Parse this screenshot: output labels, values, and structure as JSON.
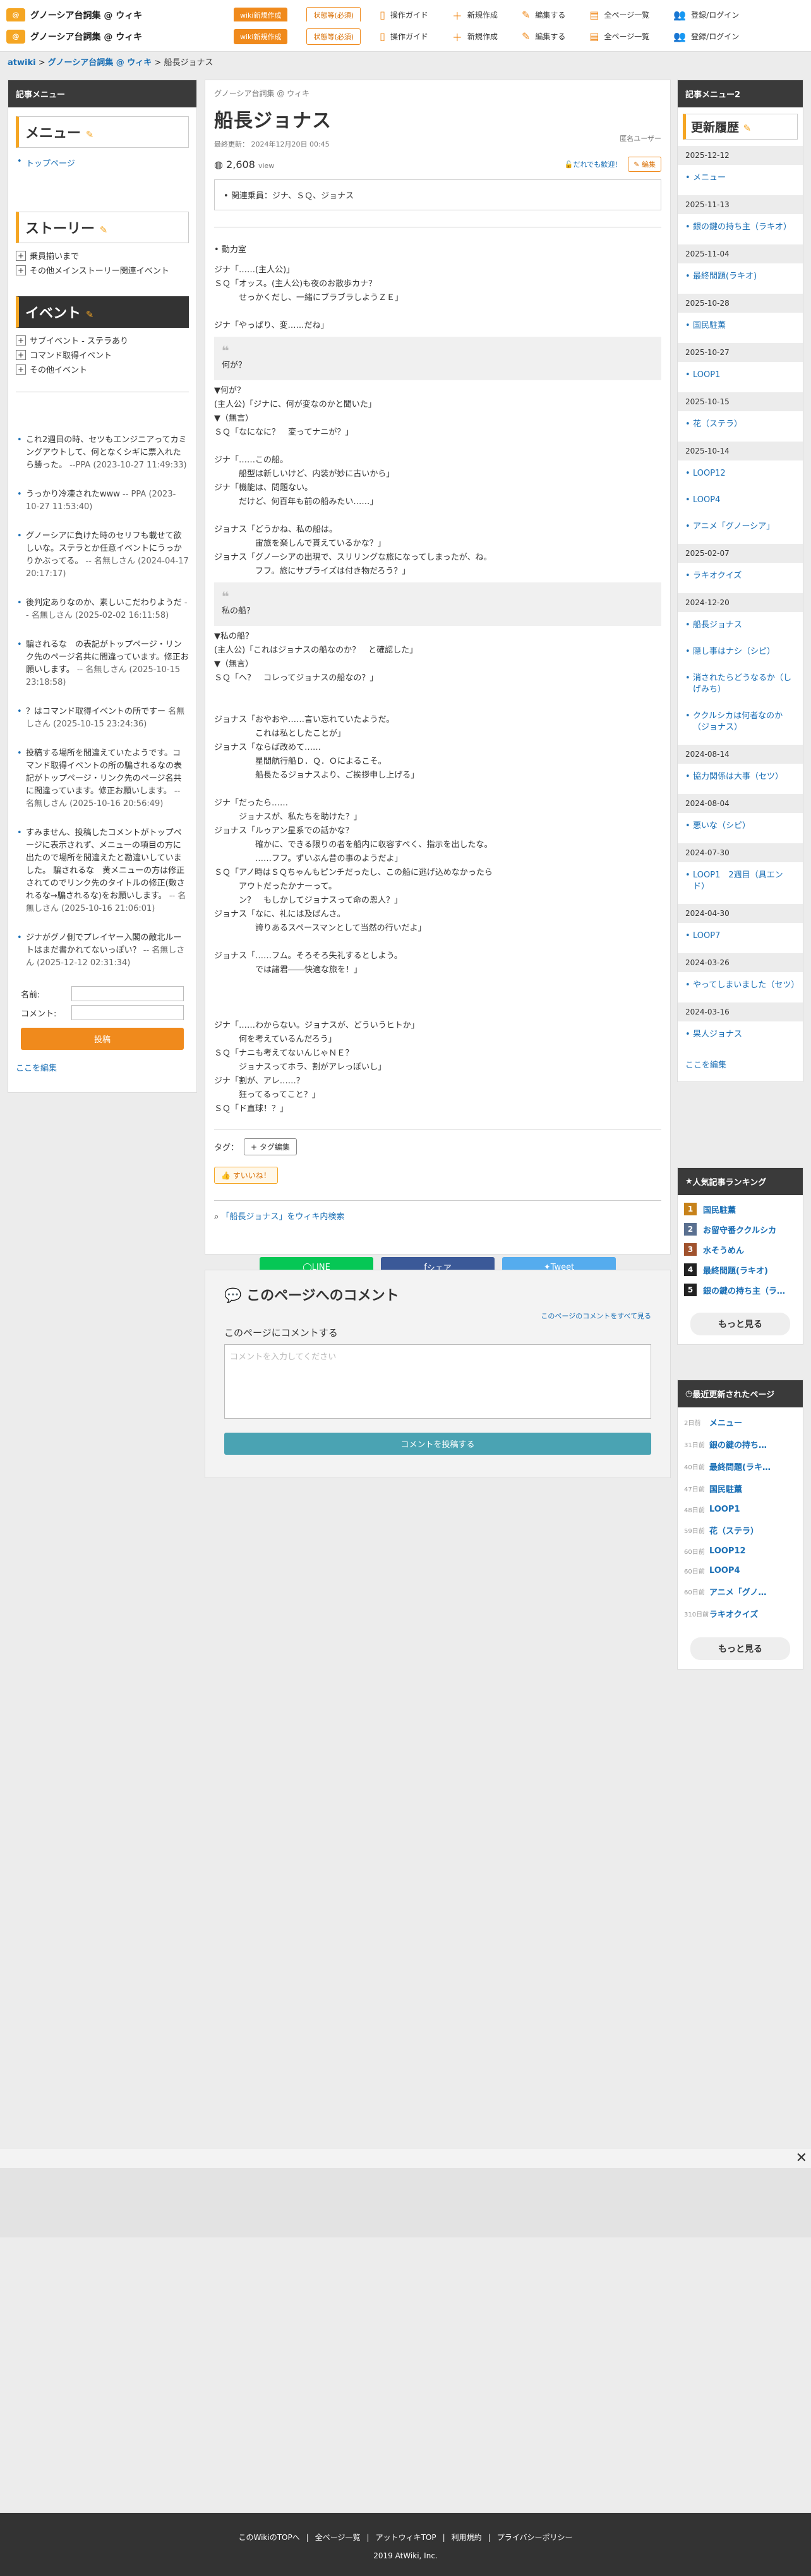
{
  "site": {
    "logo_mark": "@",
    "name": "グノーシア台詞集 @ ウィキ",
    "new_wiki_button": "wiki新規作成",
    "status_button": "状態等(必須)",
    "nav": [
      {
        "icon": "book-icon",
        "label": "操作ガイド"
      },
      {
        "icon": "plus-icon",
        "label": "新規作成"
      },
      {
        "icon": "pencil-icon",
        "label": "編集する"
      },
      {
        "icon": "list-icon",
        "label": "全ページ一覧"
      },
      {
        "icon": "users-icon",
        "label": "登録/ログイン"
      }
    ]
  },
  "breadcrumb": [
    "atwiki",
    "グノーシア台詞集 @ ウィキ",
    "船長ジョナス"
  ],
  "left_menu": {
    "header": "記事メニュー",
    "menu_title": "メニュー",
    "menu_items": [
      "トップページ"
    ],
    "story_title": "ストーリー",
    "story_items": [
      "乗員揃いまで",
      "その他メインストーリー関連イベント"
    ],
    "event_title": "イベント",
    "event_items": [
      "サブイベント - ステラあり",
      "コマンド取得イベント",
      "その他イベント"
    ],
    "comments": [
      {
        "text": "これ2週目の時、セツもエンジニアってカミングアウトして、何となくシギに票入れたら勝った。",
        "author": "--PPA (2023-10-27 11:49:33)"
      },
      {
        "text": "うっかり冷凍されたwww",
        "author": "-- PPA (2023-10-27 11:53:40)"
      },
      {
        "text": "グノーシアに負けた時のセリフも載せて欲しいな。ステラとか任意イベントにうっかりかぶってる。",
        "author": "-- 名無しさん (2024-04-17 20:17:17)"
      },
      {
        "text": "後判定ありなのか、素しいこだわりようだ",
        "author": "-- 名無しさん (2025-02-02 16:11:58)"
      },
      {
        "text": "騙されるな　の表記がトップページ・リンク先のページ名共に間違っています。修正お願いします。",
        "author": "-- 名無しさん (2025-10-15 23:18:58)"
      },
      {
        "text": "？はコマンド取得イベントの所ですー",
        "author": "名無しさん (2025-10-15 23:24:36)"
      },
      {
        "text": "投稿する場所を間違えていたようです。コマンド取得イベントの所の騙されるなの表記がトップページ・リンク先のページ名共に間違っています。修正お願いします。",
        "author": "-- 名無しさん (2025-10-16 20:56:49)"
      },
      {
        "text": "すみません、投稿したコメントがトップページに表示されず、メニューの項目の方に出たので場所を間違えたと勘違いしていました。 騙されるな　黄メニューの方は修正されてのでリンク先のタイトルの修正(敷されるな→騙されるな)をお願いします。",
        "author": "-- 名無しさん (2025-10-16 21:06:01)"
      },
      {
        "text": "ジナがグノ側でプレイヤー入閣の敵北ルートはまだ書かれてないっぽい？",
        "author": "-- 名無しさん (2025-12-12 02:31:34)"
      }
    ],
    "form": {
      "name_label": "名前:",
      "comment_label": "コメント:",
      "post": "投稿"
    },
    "edit_link": "ここを編集"
  },
  "main": {
    "site_label": "グノーシア台詞集 @ ウィキ",
    "title": "船長ジョナス",
    "updated": "最終更新： 2024年12月20日 00:45",
    "author": "匿名ユーザー",
    "views": "2,608",
    "views_unit": "view",
    "help": "だれでも歓迎！",
    "edit": "編集",
    "related": "関連乗員：ジナ、ＳＱ、ジョナス",
    "section_title": "動力室",
    "script_1": "ジナ「……(主人公)」\nＳＱ「オッス。(主人公)も夜のお散歩カナ？\n　　　せっかくだし、一緒にブラブラしようＺＥ」\n\nジナ「やっぱり、変……だね」",
    "quote_1": "何が？",
    "script_2": "▼何が？\n(主人公)「ジナに、何が変なのかと聞いた」\n▼（無言）\nＳＱ「なになに？　変ってナニが？」\n\nジナ「……この船。\n　　　船型は新しいけど、内装が妙に古いから」\nジナ「機能は、問題ない。\n　　　だけど、何百年も前の船みたい……」\n\nジョナス「どうかね、私の船は。\n　　　　　宙旅を楽しんで貰えているかな？」\nジョナス「グノーシアの出現で、スリリングな旅になってしまったが、ね。\n　　　　　フフ。旅にサプライズは付き物だろう？」",
    "quote_2": "私の船？",
    "script_3": "▼私の船？\n(主人公)「これはジョナスの船なのか？　と確認した」\n▼（無言）\nＳＱ「ヘ？　コレってジョナスの船なの？」\n\n\nジョナス「おやおや……言い忘れていたようだ。\n　　　　　これは私としたことが」\nジョナス「ならば改めて……\n　　　　　星間航行船Ｄ．Ｑ．Ｏによるこそ。\n　　　　　船長たるジョナスより、ご挨拶申し上げる」\n\nジナ「だったら……\n　　　ジョナスが、私たちを助けた？」\nジョナス「ルゥアン星系での話かな？\n　　　　　確かに、できる限りの者を船内に収容すべく、指示を出したな。\n　　　　　……フフ。ずいぶん昔の事のようだよ」\nＳＱ「アノ時はＳＱちゃんもピンチだったし、この船に逃げ込めなかったら\n　　　アウトだったかナーって。\n　　　ン？　もしかしてジョナスって命の恩人？」\nジョナス「なに、礼には及ばんさ。\n　　　　　誇りあるスペースマンとして当然の行いだよ」\n\nジョナス「……フム。そろそろ失礼するとしよう。\n　　　　　では諸君――快適な旅を！」\n\n\n\nジナ「……わからない。ジョナスが、どういうヒトか」\n　　　何を考えているんだろう」\nＳＱ「ナニも考えてないんじゃＮＥ？\n　　　ジョナスってホラ、割がアレっぽいし」\nジナ「割が、アレ……？\n　　　狂ってるってこと？」\nＳＱ「ド直球！？」",
    "tags_label": "タグ：",
    "tag_button": "+ タグ編集",
    "like": "すいいね！",
    "search_link": "「船長ジョナス」をウィキ内検索",
    "share": {
      "line": "LINE",
      "facebook": "シェア",
      "twitter": "Tweet"
    }
  },
  "comment_area": {
    "title": "このページへのコメント",
    "see_all": "このページのコメントをすべて見る",
    "label": "このページにコメントする",
    "placeholder": "コメントを入力してください",
    "submit": "コメントを投稿する"
  },
  "right": {
    "header": "記事メニュー2",
    "title": "更新履歴",
    "history": [
      {
        "date": "2025-12-12",
        "entries": [
          "メニュー"
        ]
      },
      {
        "date": "2025-11-13",
        "entries": [
          "銀の鍵の持ち主（ラキオ）"
        ]
      },
      {
        "date": "2025-11-04",
        "entries": [
          "最終問題(ラキオ)"
        ]
      },
      {
        "date": "2025-10-28",
        "entries": [
          "国民駐薫"
        ]
      },
      {
        "date": "2025-10-27",
        "entries": [
          "LOOP1"
        ]
      },
      {
        "date": "2025-10-15",
        "entries": [
          "花（ステラ）"
        ]
      },
      {
        "date": "2025-10-14",
        "entries": [
          "LOOP12",
          "LOOP4",
          "アニメ「グノーシア」"
        ]
      },
      {
        "date": "2025-02-07",
        "entries": [
          "ラキオクイズ"
        ]
      },
      {
        "date": "2024-12-20",
        "entries": [
          "船長ジョナス",
          "隠し事はナシ（シピ）",
          "消されたらどうなるか（しげみち）",
          "ククルシカは何者なのか（ジョナス）"
        ]
      },
      {
        "date": "2024-08-14",
        "entries": [
          "協力関係は大事（セツ）"
        ]
      },
      {
        "date": "2024-08-04",
        "entries": [
          "悪いな（シピ）"
        ]
      },
      {
        "date": "2024-07-30",
        "entries": [
          "LOOP1　2週目（具エンド）"
        ]
      },
      {
        "date": "2024-04-30",
        "entries": [
          "LOOP7"
        ]
      },
      {
        "date": "2024-03-26",
        "entries": [
          "やってしまいました（セツ）"
        ]
      },
      {
        "date": "2024-03-16",
        "entries": [
          "果人ジョナス"
        ]
      }
    ],
    "edit_link": "ここを編集",
    "rank_title": "人気記事ランキング",
    "ranking": [
      {
        "num": "1",
        "color": "#c7821a",
        "name": "国民駐薫"
      },
      {
        "num": "2",
        "color": "#5a7090",
        "name": "お留守番ククルシカ"
      },
      {
        "num": "3",
        "color": "#a0522d",
        "name": "水そうめん"
      },
      {
        "num": "4",
        "color": "#222222",
        "name": "最終問題(ラキオ)"
      },
      {
        "num": "5",
        "color": "#222222",
        "name": "銀の鍵の持ち主（ラ…"
      }
    ],
    "more": "もっと見る",
    "recent_title": "最近更新されたページ",
    "recent": [
      {
        "ago": "2日前",
        "name": "メニュー"
      },
      {
        "ago": "31日前",
        "name": "銀の鍵の持ち…"
      },
      {
        "ago": "40日前",
        "name": "最終問題(ラキ…"
      },
      {
        "ago": "47日前",
        "name": "国民駐薫"
      },
      {
        "ago": "48日前",
        "name": "LOOP1"
      },
      {
        "ago": "59日前",
        "name": "花（ステラ）"
      },
      {
        "ago": "60日前",
        "name": "LOOP12"
      },
      {
        "ago": "60日前",
        "name": "LOOP4"
      },
      {
        "ago": "60日前",
        "name": "アニメ「グノ…"
      },
      {
        "ago": "310日前",
        "name": "ラキオクイズ"
      }
    ]
  },
  "footer": {
    "links": [
      "このWikiのTOPへ",
      "全ページ一覧",
      "アットウィキTOP",
      "利用規約",
      "プライバシーポリシー"
    ],
    "copyright": "2019 AtWiki, Inc."
  }
}
